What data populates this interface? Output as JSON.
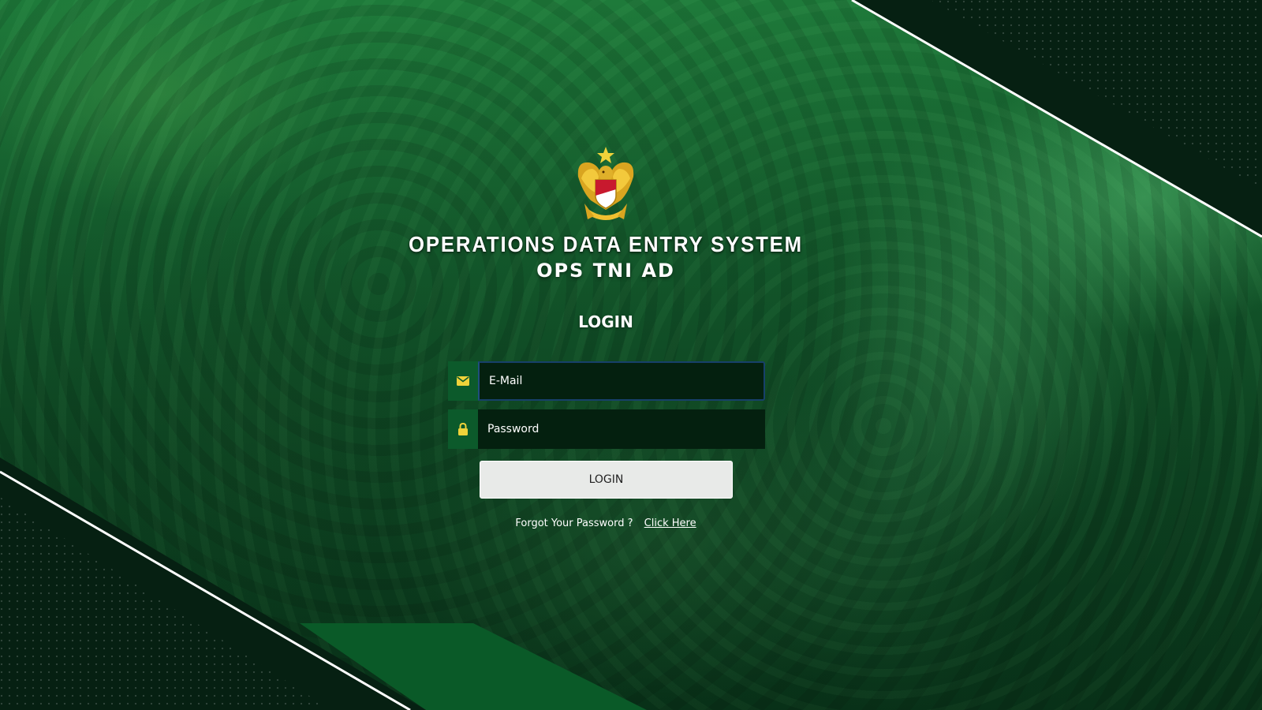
{
  "header": {
    "title": "OPERATIONS DATA ENTRY SYSTEM",
    "subtitle": "OPS TNI AD"
  },
  "login": {
    "heading": "LOGIN",
    "email_placeholder": "E-Mail",
    "password_placeholder": "Password",
    "button_label": "LOGIN",
    "forgot_text": "Forgot Your Password ?",
    "forgot_link": "Click Here"
  },
  "icons": {
    "email": "envelope-icon",
    "password": "lock-icon",
    "emblem": "army-emblem-logo"
  },
  "colors": {
    "accent": "#0c5a2b",
    "icon": "#f0d23a",
    "input_bg": "#04200f",
    "corner_dark": "#062012"
  }
}
